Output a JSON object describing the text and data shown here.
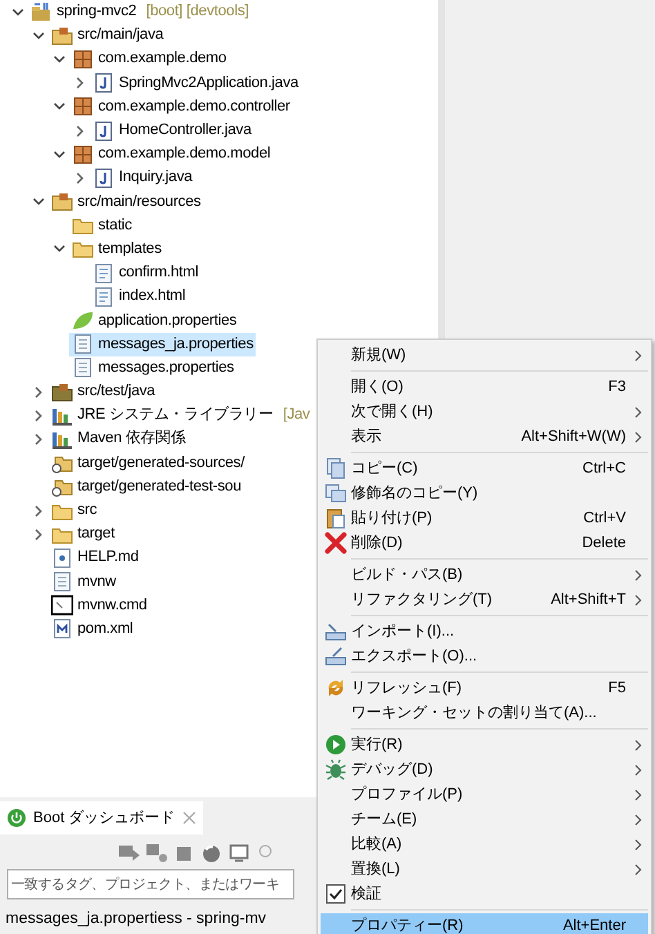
{
  "explorer": {
    "tree": [
      {
        "label": "spring-mvc2",
        "decoration": "[boot] [devtools]",
        "kind": "project",
        "expanded": true,
        "selected": false,
        "children": [
          {
            "label": "src/main/java",
            "kind": "source-folder",
            "expanded": true,
            "selected": false,
            "children": [
              {
                "label": "com.example.demo",
                "kind": "package",
                "expanded": true,
                "selected": false,
                "children": [
                  {
                    "label": "SpringMvc2Application.java",
                    "kind": "java-file",
                    "expanded": false,
                    "selected": false
                  }
                ]
              },
              {
                "label": "com.example.demo.controller",
                "kind": "package",
                "expanded": true,
                "selected": false,
                "children": [
                  {
                    "label": "HomeController.java",
                    "kind": "java-file",
                    "expanded": false,
                    "selected": false
                  }
                ]
              },
              {
                "label": "com.example.demo.model",
                "kind": "package",
                "expanded": true,
                "selected": false,
                "children": [
                  {
                    "label": "Inquiry.java",
                    "kind": "java-file",
                    "expanded": false,
                    "selected": false
                  }
                ]
              }
            ]
          },
          {
            "label": "src/main/resources",
            "kind": "source-folder",
            "expanded": true,
            "selected": false,
            "children": [
              {
                "label": "static",
                "kind": "folder",
                "selected": false
              },
              {
                "label": "templates",
                "kind": "folder",
                "expanded": true,
                "selected": false,
                "children": [
                  {
                    "label": "confirm.html",
                    "kind": "html-file",
                    "selected": false
                  },
                  {
                    "label": "index.html",
                    "kind": "html-file",
                    "selected": false
                  }
                ]
              },
              {
                "label": "application.properties",
                "kind": "spring-properties",
                "selected": false
              },
              {
                "label": "messages_ja.properties",
                "kind": "text-file",
                "selected": true
              },
              {
                "label": "messages.properties",
                "kind": "text-file",
                "selected": false
              }
            ]
          },
          {
            "label": "src/test/java",
            "kind": "test-folder",
            "expanded": false,
            "selected": false
          },
          {
            "label": "JRE システム・ライブラリー",
            "decoration": "[Jav",
            "kind": "library",
            "expanded": false,
            "selected": false
          },
          {
            "label": "Maven 依存関係",
            "kind": "library",
            "expanded": false,
            "selected": false
          },
          {
            "label": "target/generated-sources/",
            "kind": "linked-folder",
            "selected": false
          },
          {
            "label": "target/generated-test-sou",
            "kind": "linked-folder",
            "selected": false
          },
          {
            "label": "src",
            "kind": "folder",
            "expanded": false,
            "selected": false
          },
          {
            "label": "target",
            "kind": "folder",
            "expanded": false,
            "selected": false
          },
          {
            "label": "HELP.md",
            "kind": "md-file",
            "selected": false
          },
          {
            "label": "mvnw",
            "kind": "text-file",
            "selected": false
          },
          {
            "label": "mvnw.cmd",
            "kind": "cmd-file",
            "selected": false
          },
          {
            "label": "pom.xml",
            "kind": "pom-file",
            "selected": false
          }
        ]
      }
    ]
  },
  "dashboard": {
    "tab": {
      "label": "Boot ダッシュボード"
    },
    "search": {
      "placeholder": "一致するタグ、プロジェクト、またはワーキ"
    }
  },
  "status_bar": {
    "text": "messages_ja.propertiess - spring-mv"
  },
  "context_menu": {
    "groups": [
      {
        "items": [
          {
            "label": "新規(W)",
            "kind": "plain",
            "submenu": true,
            "selected": false
          }
        ]
      },
      {
        "items": [
          {
            "label": "開く(O)",
            "shortcut": "F3",
            "kind": "plain",
            "submenu": false,
            "selected": false
          },
          {
            "label": "次で開く(H)",
            "kind": "plain",
            "submenu": true,
            "selected": false
          },
          {
            "label": "表示",
            "shortcut": "Alt+Shift+W(W)",
            "kind": "plain",
            "submenu": true,
            "selected": false
          }
        ]
      },
      {
        "items": [
          {
            "label": "コピー(C)",
            "shortcut": "Ctrl+C",
            "kind": "copy",
            "submenu": false,
            "selected": false
          },
          {
            "label": "修飾名のコピー(Y)",
            "kind": "qualified-copy",
            "submenu": false,
            "selected": false
          },
          {
            "label": "貼り付け(P)",
            "shortcut": "Ctrl+V",
            "kind": "paste",
            "submenu": false,
            "selected": false
          },
          {
            "label": "削除(D)",
            "shortcut": "Delete",
            "kind": "delete",
            "submenu": false,
            "selected": false
          }
        ]
      },
      {
        "items": [
          {
            "label": "ビルド・パス(B)",
            "kind": "plain",
            "submenu": true,
            "selected": false
          },
          {
            "label": "リファクタリング(T)",
            "shortcut": "Alt+Shift+T",
            "kind": "plain",
            "submenu": true,
            "selected": false
          }
        ]
      },
      {
        "items": [
          {
            "label": "インポート(I)...",
            "kind": "import",
            "submenu": false,
            "selected": false
          },
          {
            "label": "エクスポート(O)...",
            "kind": "export",
            "submenu": false,
            "selected": false
          }
        ]
      },
      {
        "items": [
          {
            "label": "リフレッシュ(F)",
            "shortcut": "F5",
            "kind": "refresh",
            "submenu": false,
            "selected": false
          },
          {
            "label": "ワーキング・セットの割り当て(A)...",
            "kind": "plain",
            "submenu": false,
            "selected": false
          }
        ]
      },
      {
        "items": [
          {
            "label": "実行(R)",
            "kind": "run",
            "submenu": true,
            "selected": false
          },
          {
            "label": "デバッグ(D)",
            "kind": "debug",
            "submenu": true,
            "selected": false
          },
          {
            "label": "プロファイル(P)",
            "kind": "plain",
            "submenu": true,
            "selected": false
          },
          {
            "label": "チーム(E)",
            "kind": "plain",
            "submenu": true,
            "selected": false
          },
          {
            "label": "比較(A)",
            "kind": "plain",
            "submenu": true,
            "selected": false
          },
          {
            "label": "置換(L)",
            "kind": "plain",
            "submenu": true,
            "selected": false
          },
          {
            "label": "検証",
            "kind": "checkbox",
            "checked": true,
            "submenu": false,
            "selected": false
          }
        ]
      },
      {
        "items": [
          {
            "label": "プロパティー(R)",
            "shortcut": "Alt+Enter",
            "kind": "plain",
            "submenu": false,
            "selected": true
          }
        ]
      }
    ]
  }
}
